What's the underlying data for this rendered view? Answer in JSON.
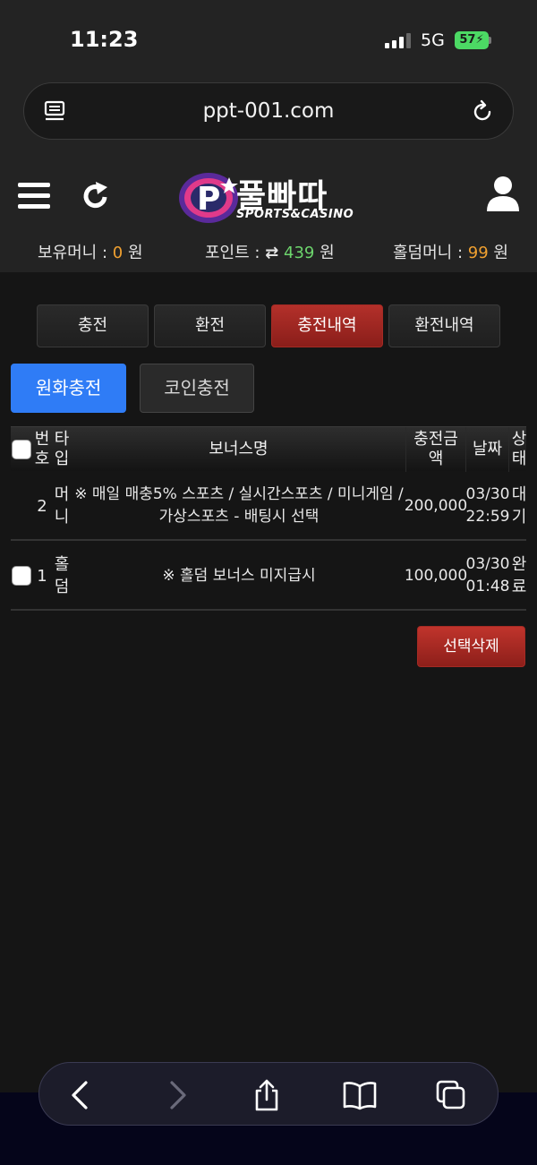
{
  "status_bar": {
    "time": "11:23",
    "network": "5G",
    "battery": "57"
  },
  "browser": {
    "url": "ppt-001.com"
  },
  "site": {
    "logo_kor": "풀빠따",
    "logo_eng": "SPORTS&CASINO",
    "balances": {
      "money_label": "보유머니 :",
      "money_value": "0",
      "money_unit": "원",
      "point_label": "포인트 :",
      "point_value": "439",
      "point_unit": "원",
      "holdem_label": "홀덤머니 :",
      "holdem_value": "99",
      "holdem_unit": "원"
    }
  },
  "tabs": [
    "충전",
    "환전",
    "충전내역",
    "환전내역"
  ],
  "sub_tabs": [
    "원화충전",
    "코인충전"
  ],
  "table": {
    "headers": {
      "number": "번\n호",
      "type": "타\n입",
      "bonus_name": "보너스명",
      "amount": "충전금액",
      "date": "날짜",
      "status": "상\n태"
    },
    "rows": [
      {
        "number": "2",
        "type": "머\n니",
        "bonus_name": "※ 매일 매충5% 스포츠 / 실시간스포츠 / 미니게임 / 가상스포츠 - 배팅시 선택",
        "amount": "200,000",
        "date": "03/30\n22:59",
        "status": "대\n기"
      },
      {
        "number": "1",
        "type": "홀\n덤",
        "bonus_name": "※ 홀덤 보너스 미지급시",
        "amount": "100,000",
        "date": "03/30\n01:48",
        "status": "완\n료"
      }
    ]
  },
  "delete_button": "선택삭제",
  "colors": {
    "accent_red": "#b3302a",
    "accent_blue": "#2f7cf6",
    "orange": "#f0a030",
    "green": "#6cd46c"
  }
}
